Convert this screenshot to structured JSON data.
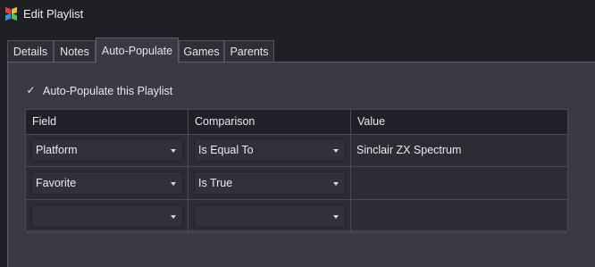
{
  "window": {
    "title": "Edit Playlist"
  },
  "tabs": [
    {
      "label": "Details"
    },
    {
      "label": "Notes"
    },
    {
      "label": "Auto-Populate"
    },
    {
      "label": "Games"
    },
    {
      "label": "Parents"
    }
  ],
  "active_tab": "Auto-Populate",
  "auto_populate": {
    "label": "Auto-Populate this Playlist",
    "checked": true
  },
  "grid": {
    "columns": [
      "Field",
      "Comparison",
      "Value"
    ],
    "rows": [
      {
        "field": "Platform",
        "comparison": "Is Equal To",
        "value": "Sinclair ZX Spectrum"
      },
      {
        "field": "Favorite",
        "comparison": "Is True",
        "value": ""
      },
      {
        "field": "",
        "comparison": "",
        "value": ""
      }
    ]
  }
}
